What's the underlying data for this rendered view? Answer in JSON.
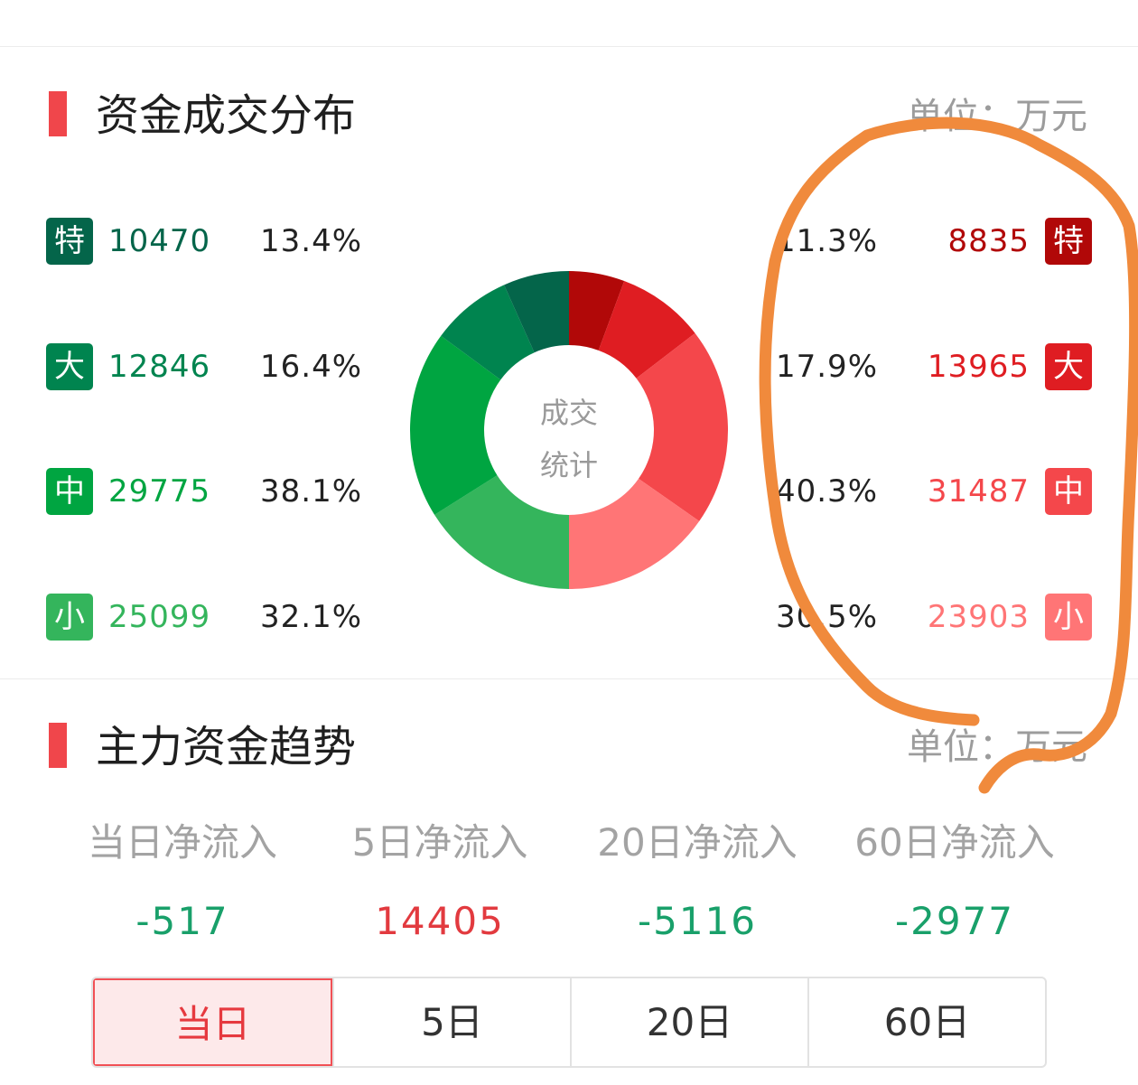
{
  "distribution": {
    "title": "资金成交分布",
    "unit": "单位：万元",
    "center_label_line1": "成交",
    "center_label_line2": "统计",
    "outflow": [
      {
        "tag": "特",
        "amount": "10470",
        "pct": "13.4%"
      },
      {
        "tag": "大",
        "amount": "12846",
        "pct": "16.4%"
      },
      {
        "tag": "中",
        "amount": "29775",
        "pct": "38.1%"
      },
      {
        "tag": "小",
        "amount": "25099",
        "pct": "32.1%"
      }
    ],
    "inflow": [
      {
        "tag": "特",
        "amount": "8835",
        "pct": "11.3%"
      },
      {
        "tag": "大",
        "amount": "13965",
        "pct": "17.9%"
      },
      {
        "tag": "中",
        "amount": "31487",
        "pct": "40.3%"
      },
      {
        "tag": "小",
        "amount": "23903",
        "pct": "30.5%"
      }
    ],
    "colors": {
      "out": [
        "#04654a",
        "#00844f",
        "#00a541",
        "#34b55c"
      ],
      "in": [
        "#b10808",
        "#df1d22",
        "#f4474b",
        "#ff7576"
      ]
    }
  },
  "chart_data": {
    "type": "pie",
    "slices": [
      {
        "label": "特",
        "side": "in",
        "value": 8835
      },
      {
        "label": "大",
        "side": "in",
        "value": 13965
      },
      {
        "label": "中",
        "side": "in",
        "value": 31487
      },
      {
        "label": "小",
        "side": "in",
        "value": 23903
      },
      {
        "label": "小",
        "side": "out",
        "value": 25099
      },
      {
        "label": "中",
        "side": "out",
        "value": 29775
      },
      {
        "label": "大",
        "side": "out",
        "value": 12846
      },
      {
        "label": "特",
        "side": "out",
        "value": 10470
      }
    ]
  },
  "trend": {
    "title": "主力资金趋势",
    "unit": "单位：万元",
    "flows": [
      {
        "label": "当日净流入",
        "value": "-517",
        "color": "#19a06a"
      },
      {
        "label": "5日净流入",
        "value": "14405",
        "color": "#e23a3f"
      },
      {
        "label": "20日净流入",
        "value": "-5116",
        "color": "#19a06a"
      },
      {
        "label": "60日净流入",
        "value": "-2977",
        "color": "#19a06a"
      }
    ],
    "tabs": [
      {
        "label": "当日",
        "active": true
      },
      {
        "label": "5日",
        "active": false
      },
      {
        "label": "20日",
        "active": false
      },
      {
        "label": "60日",
        "active": false
      }
    ]
  }
}
